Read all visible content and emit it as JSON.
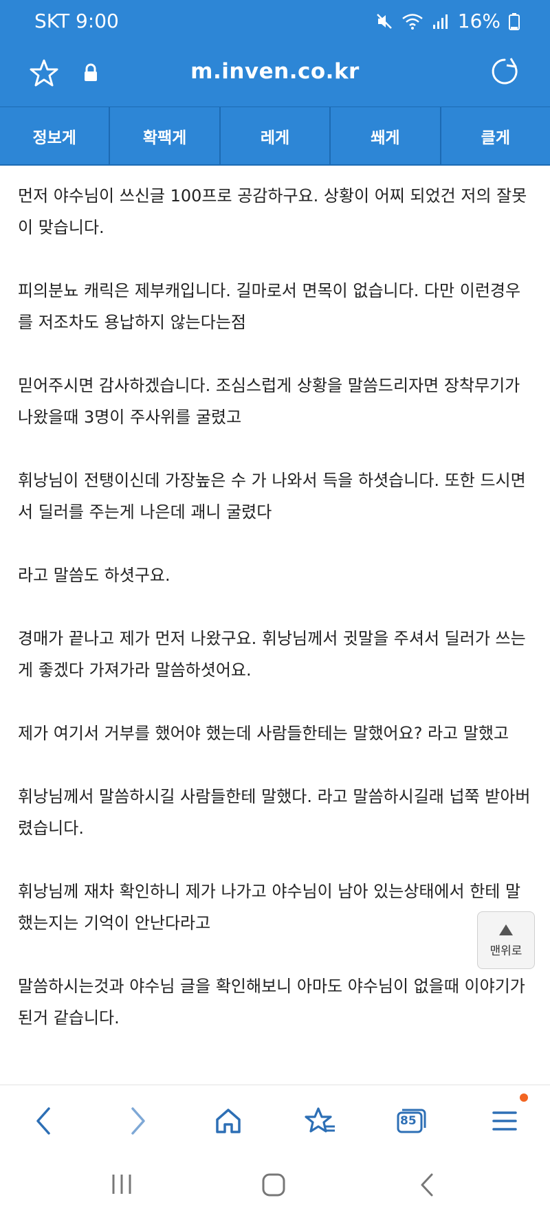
{
  "status_bar": {
    "carrier_time": "SKT 9:00",
    "battery": "16%"
  },
  "browser": {
    "url": "m.inven.co.kr"
  },
  "tabs": [
    {
      "label": "정보게"
    },
    {
      "label": "확팩게"
    },
    {
      "label": "레게"
    },
    {
      "label": "쐐게"
    },
    {
      "label": "클게"
    }
  ],
  "article": {
    "paragraphs": [
      "먼저 야수님이 쓰신글 100프로 공감하구요. 상황이 어찌 되었건 저의 잘못이 맞습니다.",
      "피의분뇨 캐릭은 제부캐입니다. 길마로서 면목이 없습니다.  다만 이런경우를 저조차도 용납하지 않는다는점",
      "믿어주시면 감사하겠습니다.  조심스럽게 상황을 말씀드리자면 장착무기가 나왔을때 3명이 주사위를 굴렸고",
      "휘낭님이 전탱이신데 가장높은 수 가 나와서 득을 하셧습니다.  또한 드시면서 딜러를 주는게 나은데 괘니 굴렸다",
      "라고 말씀도 하셧구요.",
      "경매가 끝나고 제가 먼저 나왔구요.  휘낭님께서 귓말을 주셔서 딜러가 쓰는게 좋겠다 가져가라 말씀하셧어요.",
      "제가 여기서 거부를 했어야 했는데   사람들한테는 말했어요?   라고 말했고",
      "휘낭님께서 말씀하시길 사람들한테 말했다. 라고 말씀하시길래 넙쭉 받아버렸습니다.",
      "휘낭님께 재차 확인하니 제가 나가고 야수님이 남아 있는상태에서 한테 말했는지는 기억이 안난다라고",
      "말씀하시는것과  야수님 글을 확인해보니 아마도 야수님이 없을때 이야기가 된거 같습니다."
    ]
  },
  "to_top": {
    "label": "맨위로"
  },
  "bottom_nav": {
    "tabs_count": "85"
  },
  "icons": {
    "star": "star-icon",
    "lock": "lock-icon",
    "reload": "reload-icon",
    "back": "chevron-left-icon",
    "forward": "chevron-right-icon",
    "home": "home-icon",
    "bookmarks": "bookmark-star-icon",
    "tabs": "tabs-icon",
    "menu": "menu-icon"
  },
  "colors": {
    "header": "#2d86d6",
    "notification_dot": "#f26522"
  }
}
